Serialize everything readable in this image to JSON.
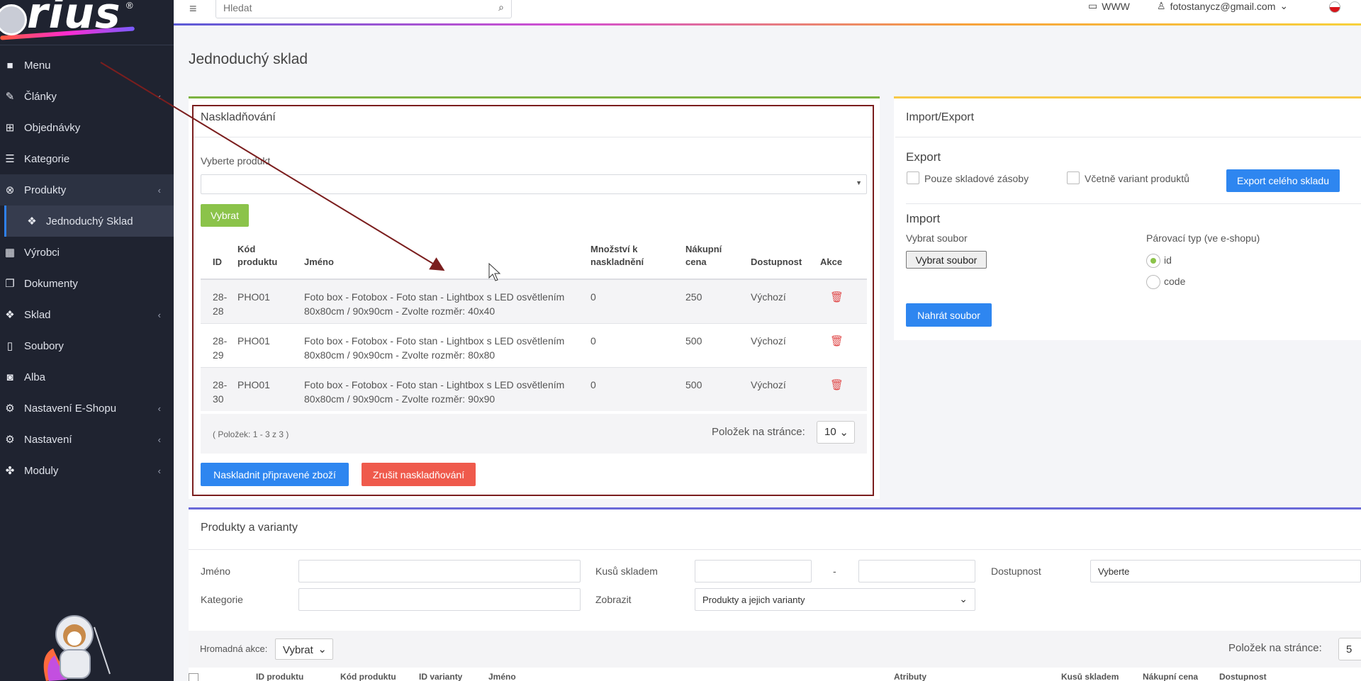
{
  "brand": {
    "logo_text": "rius",
    "logo_reg": "®"
  },
  "sidebar": {
    "items": [
      {
        "label": "Menu",
        "icon": "folder-icon"
      },
      {
        "label": "Články",
        "icon": "pencil-icon"
      },
      {
        "label": "Objednávky",
        "icon": "cart-icon"
      },
      {
        "label": "Kategorie",
        "icon": "list-icon"
      },
      {
        "label": "Produkty",
        "icon": "basketball-icon"
      },
      {
        "label": "Jednoduchý Sklad",
        "icon": "dropbox-icon"
      },
      {
        "label": "Výrobci",
        "icon": "building-icon"
      },
      {
        "label": "Dokumenty",
        "icon": "copy-icon"
      },
      {
        "label": "Sklad",
        "icon": "dropbox-icon"
      },
      {
        "label": "Soubory",
        "icon": "file-icon"
      },
      {
        "label": "Alba",
        "icon": "camera-icon"
      },
      {
        "label": "Nastavení E-Shopu",
        "icon": "cogs-icon"
      },
      {
        "label": "Nastavení",
        "icon": "cogs-icon"
      },
      {
        "label": "Moduly",
        "icon": "plugin-icon"
      }
    ],
    "chevron": "‹"
  },
  "topbar": {
    "search_placeholder": "Hledat",
    "www_label": "WWW",
    "user_email": "fotostanycz@gmail.com"
  },
  "page": {
    "title": "Jednoduchý sklad"
  },
  "stock": {
    "title": "Naskladňování",
    "select_label": "Vyberte produkt",
    "select_button": "Vybrat",
    "columns": [
      "ID",
      "Kód produktu",
      "Jméno",
      "Množství k naskladnění",
      "Nákupní cena",
      "Dostupnost",
      "Akce"
    ],
    "rows": [
      {
        "id": "28-28",
        "code": "PHO01",
        "name": "Foto box - Fotobox - Foto stan - Lightbox s LED osvětlením 80x80cm / 90x90cm - Zvolte rozměr: 40x40",
        "qty": "0",
        "price": "250",
        "availability": "Výchozí"
      },
      {
        "id": "28-29",
        "code": "PHO01",
        "name": "Foto box - Fotobox - Foto stan - Lightbox s LED osvětlením 80x80cm / 90x90cm - Zvolte rozměr: 80x80",
        "qty": "0",
        "price": "500",
        "availability": "Výchozí"
      },
      {
        "id": "28-30",
        "code": "PHO01",
        "name": "Foto box - Fotobox - Foto stan - Lightbox s LED osvětlením 80x80cm / 90x90cm - Zvolte rozměr: 90x90",
        "qty": "0",
        "price": "500",
        "availability": "Výchozí"
      }
    ],
    "count_text": "( Položek: 1 - 3 z 3 )",
    "per_page_label": "Položek na stránce:",
    "per_page_value": "10",
    "btn_stock": "Naskladnit připravené zboží",
    "btn_cancel": "Zrušit naskladňování"
  },
  "io": {
    "title": "Import/Export",
    "export_heading": "Export",
    "chk_stock_only": "Pouze skladové zásoby",
    "chk_variants": "Včetně variant produktů",
    "btn_export": "Export celého skladu",
    "import_heading": "Import",
    "file_label": "Vybrat soubor",
    "file_button": "Vybrat soubor",
    "pair_label": "Párovací typ (ve e-shopu)",
    "radio_id": "id",
    "radio_code": "code",
    "btn_upload": "Nahrát soubor"
  },
  "pv": {
    "title": "Produkty a varianty",
    "name_label": "Jméno",
    "stock_label": "Kusů skladem",
    "dash": "-",
    "avail_label": "Dostupnost",
    "avail_value": "Vyberte",
    "cat_label": "Kategorie",
    "show_label": "Zobrazit",
    "show_value": "Produkty a jejich varianty",
    "bulk_label": "Hromadná akce:",
    "bulk_value": "Vybrat",
    "per_page_label": "Položek na stránce:",
    "per_page_value": "5",
    "headers": [
      "ID produktu",
      "Kód produktu",
      "ID varianty",
      "Jméno",
      "Atributy",
      "Kusů skladem",
      "Nákupní cena",
      "Dostupnost"
    ]
  }
}
